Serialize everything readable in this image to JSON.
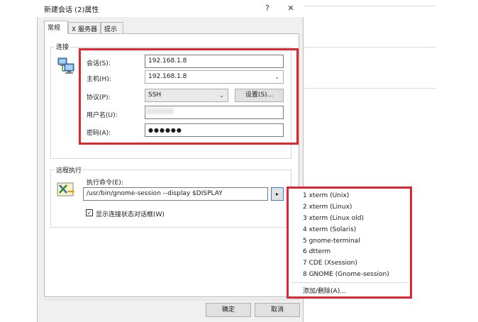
{
  "window": {
    "title": "新建会话 (2)属性",
    "help_label": "?",
    "close_label": "✕"
  },
  "tabs": [
    {
      "label": "常规"
    },
    {
      "label": "X 服务器"
    },
    {
      "label": "提示"
    }
  ],
  "connection": {
    "group_label": "连接",
    "session_label": "会话(S):",
    "session_value": "192.168.1.8",
    "host_label": "主机(H):",
    "host_value": "192.168.1.8",
    "protocol_label": "协议(P):",
    "protocol_value": "SSH",
    "settings_button": "设置(S)...",
    "username_label": "用户名(U):",
    "username_value": "",
    "password_label": "密码(A):",
    "password_value": "●●●●●●"
  },
  "remote": {
    "group_label": "远程执行",
    "command_label": "执行命令(E):",
    "command_value": "/usr/bin/gnome-session --display $DISPLAY",
    "dropdown_arrow": "▸",
    "checkbox_label": "显示连接状态对话框(W)",
    "checkbox_mark": "✓"
  },
  "menu": {
    "items": [
      {
        "label": "1 xterm (Unix)"
      },
      {
        "label": "2 xterm (Linux)"
      },
      {
        "label": "3 xterm (Linux old)"
      },
      {
        "label": "4 xterm (Solaris)"
      },
      {
        "label": "5 gnome-terminal"
      },
      {
        "label": "6 dtterm"
      },
      {
        "label": "7 CDE (Xsession)"
      },
      {
        "label": "8 GNOME (Gnome-session)"
      }
    ],
    "add_remove": "添加/删除(A)..."
  },
  "footer": {
    "ok_button": "确定",
    "cancel_button": "取消"
  },
  "icons": {
    "connection_icon": "network-computers-icon",
    "remote_icon": "remote-exec-icon"
  },
  "colors": {
    "highlight_red": "#e0262f",
    "dialog_bg": "#f0f0f0"
  }
}
